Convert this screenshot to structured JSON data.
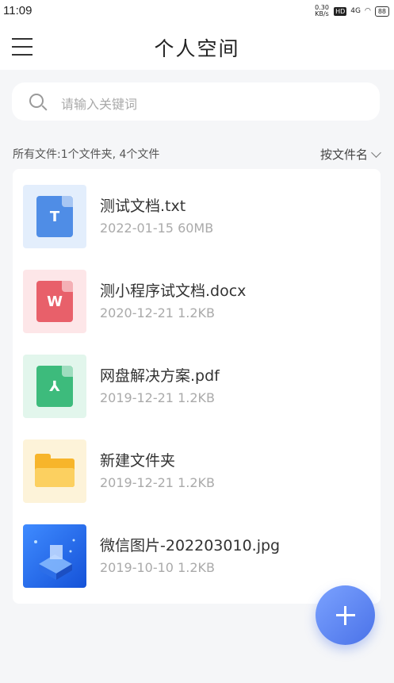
{
  "status_bar": {
    "time": "11:09",
    "net_speed_top": "0.30",
    "net_speed_bottom": "KB/s",
    "hd": "HD",
    "signal": "4G",
    "battery": "88"
  },
  "header": {
    "title": "个人空间"
  },
  "search": {
    "placeholder": "请输入关键词"
  },
  "summary": {
    "text": "所有文件:1个文件夹, 4个文件",
    "sort_label": "按文件名"
  },
  "files": [
    {
      "name": "测试文档.txt",
      "meta": "2022-01-15  60MB",
      "type": "txt",
      "letter": "T",
      "thumb_bg": "#e3eefc",
      "icon_color": "#4f8de6"
    },
    {
      "name": "测小程序试文档.docx",
      "meta": "2020-12-21  1.2KB",
      "type": "docx",
      "letter": "W",
      "thumb_bg": "#fde6e8",
      "icon_color": "#e8606a"
    },
    {
      "name": "网盘解决方案.pdf",
      "meta": "2019-12-21  1.2KB",
      "type": "pdf",
      "letter": "⅄",
      "thumb_bg": "#e2f6ec",
      "icon_color": "#3dbb7c"
    },
    {
      "name": "新建文件夹",
      "meta": "2019-12-21  1.2KB",
      "type": "folder",
      "thumb_bg": "#fdf3d9"
    },
    {
      "name": "微信图片-202203010.jpg",
      "meta": "2019-10-10  1.2KB",
      "type": "image"
    }
  ],
  "fab": {
    "icon": "plus-icon"
  }
}
